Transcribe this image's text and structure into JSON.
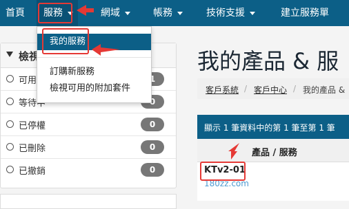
{
  "navbar": {
    "home": "首頁",
    "services": "服務",
    "domains": "網域",
    "billing": "帳務",
    "support": "技術支援",
    "open_ticket": "建立服務單"
  },
  "dropdown": {
    "items": [
      "我的服務",
      "訂購新服務",
      "檢視可用的附加套件"
    ]
  },
  "filter_panel": {
    "title": "檢視",
    "statuses": [
      {
        "label": "可用",
        "count": "1"
      },
      {
        "label": "等待中",
        "count": "0"
      },
      {
        "label": "已停權",
        "count": "0"
      },
      {
        "label": "已刪除",
        "count": "0"
      },
      {
        "label": "已撤銷",
        "count": "0"
      }
    ]
  },
  "page": {
    "title": "我的產品 & 服",
    "breadcrumb": [
      "客戶系統",
      "客戶中心",
      "我的產品 &"
    ]
  },
  "table": {
    "info": "顯示 1 筆資料中的第 1 筆至第 1 筆",
    "column_header": "產品 / 服務",
    "rows": [
      {
        "name": "KTv2-01",
        "domain": "180zz.com"
      }
    ]
  },
  "colors": {
    "nav": "#0c5f87",
    "annotation": "#e53935",
    "badge": "#777777"
  }
}
